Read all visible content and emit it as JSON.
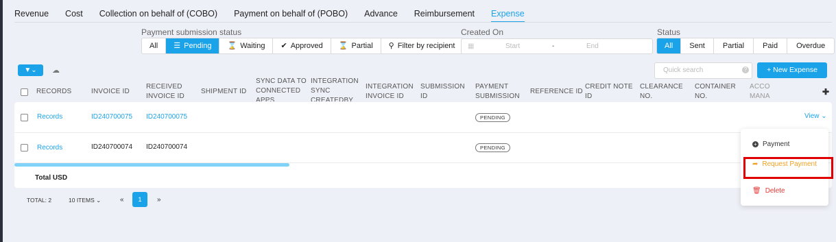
{
  "tabs": [
    "Revenue",
    "Cost",
    "Collection on behalf of (COBO)",
    "Payment on behalf of (POBO)",
    "Advance",
    "Reimbursement",
    "Expense"
  ],
  "filters": {
    "payment_status_label": "Payment submission status",
    "payment_status_options": [
      "All",
      "Pending",
      "Waiting",
      "Approved",
      "Partial",
      "Filter by recipient"
    ],
    "created_on_label": "Created On",
    "date_start": "Start",
    "date_sep": "-",
    "date_end": "End",
    "status_label": "Status",
    "status_options": [
      "All",
      "Sent",
      "Partial",
      "Paid",
      "Overdue"
    ]
  },
  "toolbar": {
    "filter_icon": "filter-icon",
    "export_icon": "cloud-download-icon",
    "search_placeholder": "Quick search",
    "search_help": "?",
    "new_expense": "+ New Expense"
  },
  "columns": [
    "RECORDS",
    "INVOICE ID",
    "RECEIVED INVOICE ID",
    "SHIPMENT ID",
    "SYNC DATA TO CONNECTED APPS",
    "INTEGRATION SYNC CREATEDBY",
    "INTEGRATION INVOICE ID",
    "SUBMISSION ID",
    "PAYMENT SUBMISSION",
    "REFERENCE ID",
    "CREDIT NOTE ID",
    "CLEARANCE NO.",
    "CONTAINER NO.",
    "ACCO MANA"
  ],
  "rows": [
    {
      "records": "Records",
      "invoice_id": "ID240700075",
      "received_invoice_id": "ID240700075",
      "payment_submission": "PENDING"
    },
    {
      "records": "Records",
      "invoice_id": "ID240700074",
      "received_invoice_id": "ID240700074",
      "payment_submission": "PENDING"
    }
  ],
  "total_label": "Total USD",
  "pagination": {
    "total": "TOTAL: 2",
    "per_page": "10 ITEMS",
    "prev": "«",
    "page": "1",
    "next": "»"
  },
  "row_action": {
    "view": "View"
  },
  "menu": {
    "payment": "Payment",
    "request_payment": "Request Payment",
    "delete": "Delete"
  },
  "colors": {
    "accent": "#1ba3ea",
    "warning": "#f0a020",
    "danger": "#e53935",
    "highlight": "#e00000"
  }
}
